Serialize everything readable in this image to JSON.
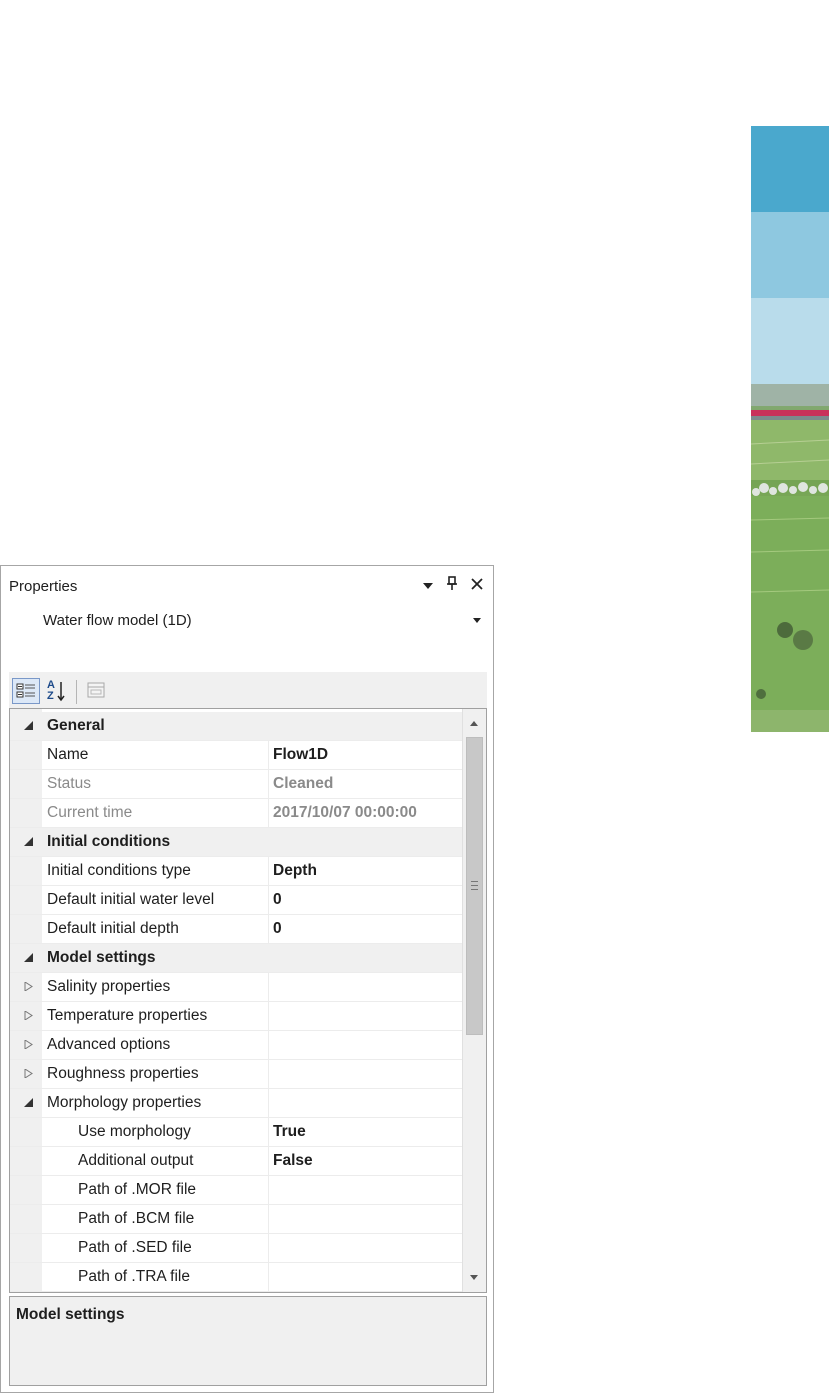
{
  "panel": {
    "title": "Properties",
    "selected_object": "Water flow model (1D)"
  },
  "colors": {
    "deco_band_1": "#4aa8cd",
    "deco_band_2": "#8ec8e0",
    "deco_band_3": "#b9dceb",
    "category_background": "#f0f0f0",
    "disabled_text": "#8a8a8a"
  },
  "icons": {
    "dropdown": "triangle-down",
    "pin": "pin",
    "close": "x",
    "categorized": "categorized-grid",
    "alphabetical": "sort-a-z",
    "property_pages": "property-pages",
    "expanded": "triangle-down-right",
    "collapsed": "triangle-right-outline"
  },
  "toolbar": {
    "az_top": "A",
    "az_bottom": "Z"
  },
  "grid": {
    "categories": [
      {
        "label": "General",
        "rows": [
          {
            "name": "Name",
            "value": "Flow1D"
          },
          {
            "name": "Status",
            "value": "Cleaned"
          },
          {
            "name": "Current time",
            "value": "2017/10/07 00:00:00"
          }
        ]
      },
      {
        "label": "Initial conditions",
        "rows": [
          {
            "name": "Initial conditions type",
            "value": "Depth"
          },
          {
            "name": "Default initial water level",
            "value": "0"
          },
          {
            "name": "Default initial depth",
            "value": "0"
          }
        ]
      },
      {
        "label": "Model settings",
        "rows": [
          {
            "name": "Salinity properties",
            "value": ""
          },
          {
            "name": "Temperature properties",
            "value": ""
          },
          {
            "name": "Advanced options",
            "value": ""
          },
          {
            "name": "Roughness properties",
            "value": ""
          },
          {
            "name": "Morphology properties",
            "value": ""
          },
          {
            "name": "Use morphology",
            "value": "True"
          },
          {
            "name": "Additional output",
            "value": "False"
          },
          {
            "name": "Path of .MOR file",
            "value": ""
          },
          {
            "name": "Path of .BCM file",
            "value": ""
          },
          {
            "name": "Path of .SED file",
            "value": ""
          },
          {
            "name": "Path of .TRA file",
            "value": ""
          }
        ]
      }
    ]
  },
  "description": {
    "title": "Model settings"
  }
}
